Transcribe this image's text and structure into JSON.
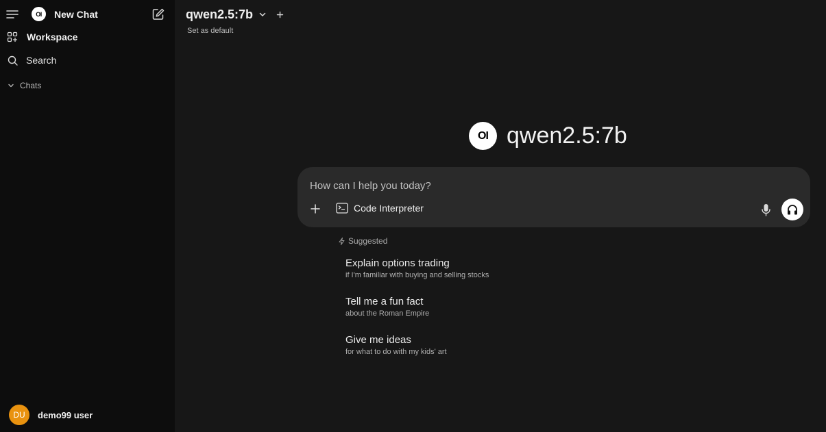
{
  "sidebar": {
    "new_chat": {
      "label": "New Chat",
      "logo_text": "OI"
    },
    "workspace": {
      "label": "Workspace"
    },
    "search": {
      "label": "Search"
    },
    "chats": {
      "label": "Chats"
    },
    "user": {
      "initials": "DU",
      "name": "demo99 user",
      "avatar_color": "#e9920f"
    }
  },
  "header": {
    "model_name": "qwen2.5:7b",
    "set_default": "Set as default"
  },
  "main": {
    "hero_logo_text": "OI",
    "hero_title": "qwen2.5:7b",
    "composer": {
      "placeholder": "How can I help you today?",
      "value": "",
      "code_interpreter_label": "Code Interpreter"
    },
    "suggested": {
      "label": "Suggested",
      "items": [
        {
          "title": "Explain options trading",
          "subtitle": "if I'm familiar with buying and selling stocks"
        },
        {
          "title": "Tell me a fun fact",
          "subtitle": "about the Roman Empire"
        },
        {
          "title": "Give me ideas",
          "subtitle": "for what to do with my kids' art"
        }
      ]
    }
  },
  "icons": [
    "menu-icon",
    "compose-icon",
    "workspace-icon",
    "search-icon",
    "chevron-down-icon",
    "plus-icon",
    "terminal-icon",
    "microphone-icon",
    "headphones-icon",
    "sparkle-icon"
  ],
  "colors": {
    "background": "#171717",
    "sidebar": "#0d0d0d",
    "composer": "#2a2a2a",
    "avatar": "#e9920f"
  }
}
